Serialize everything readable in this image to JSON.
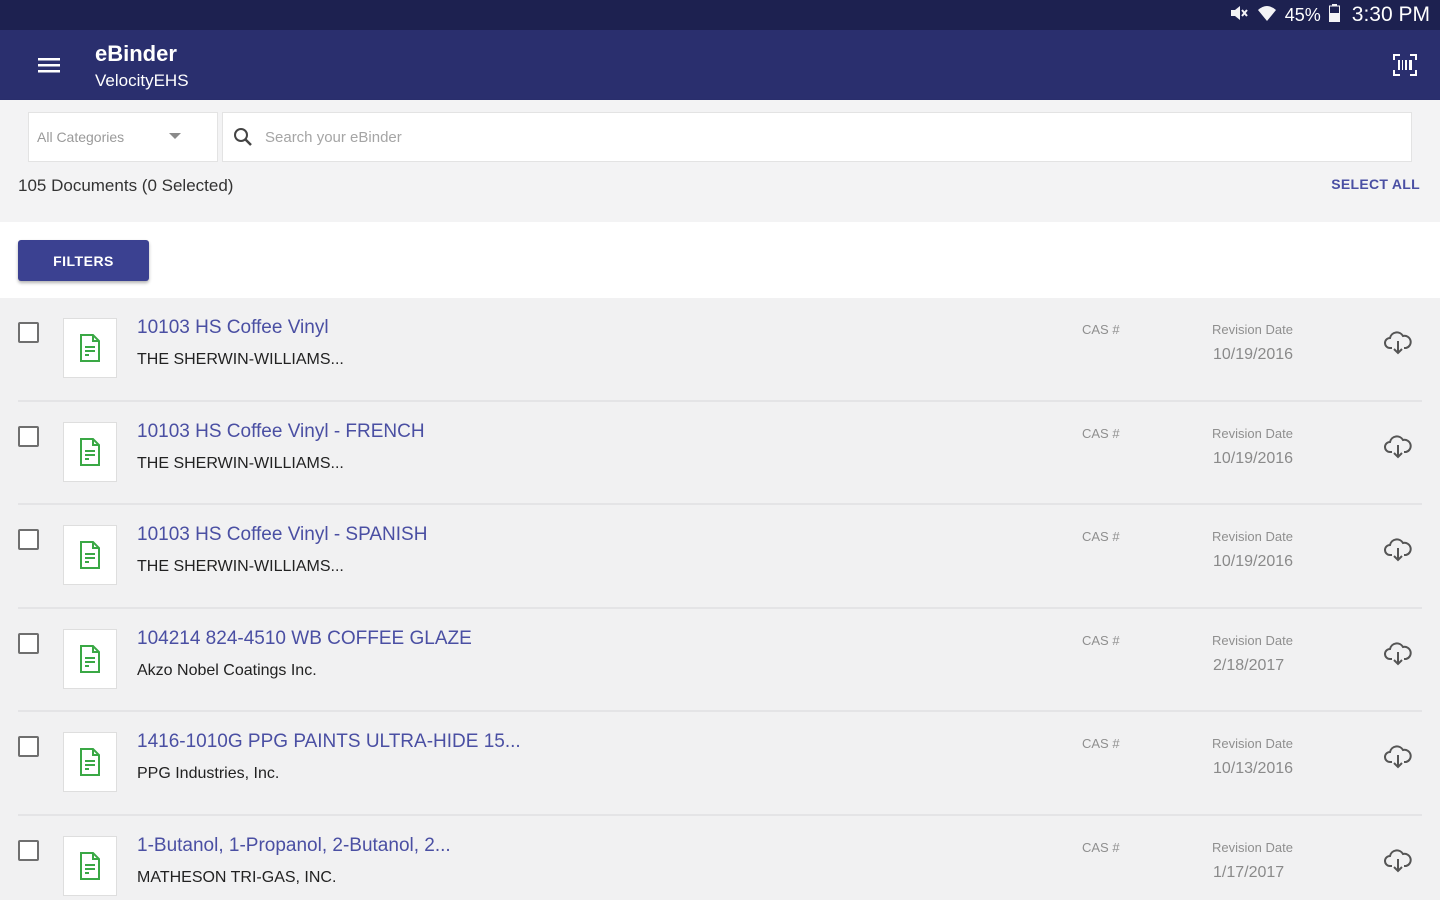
{
  "status_bar": {
    "battery": "45%",
    "time": "3:30 PM",
    "icons": [
      "mute-icon",
      "wifi-icon",
      "battery-icon"
    ]
  },
  "app_bar": {
    "title": "eBinder",
    "subtitle": "VelocityEHS",
    "background": "#2a2f6e"
  },
  "search": {
    "category": "All Categories",
    "placeholder": "Search your eBinder"
  },
  "summary": {
    "count_text": "105 Documents (0 Selected)",
    "select_all_label": "SELECT ALL"
  },
  "filters": {
    "label": "FILTERS"
  },
  "documents": [
    {
      "title": "10103 HS Coffee Vinyl",
      "manufacturer": "THE SHERWIN-WILLIAMS...",
      "cas_label": "CAS #",
      "revision_label": "Revision Date",
      "revision_date": "10/19/2016"
    },
    {
      "title": "10103 HS Coffee Vinyl - FRENCH",
      "manufacturer": "THE SHERWIN-WILLIAMS...",
      "cas_label": "CAS #",
      "revision_label": "Revision Date",
      "revision_date": "10/19/2016"
    },
    {
      "title": "10103 HS Coffee Vinyl - SPANISH",
      "manufacturer": "THE SHERWIN-WILLIAMS...",
      "cas_label": "CAS #",
      "revision_label": "Revision Date",
      "revision_date": "10/19/2016"
    },
    {
      "title": "104214 824-4510 WB COFFEE GLAZE",
      "manufacturer": "Akzo Nobel Coatings Inc.",
      "cas_label": "CAS #",
      "revision_label": "Revision Date",
      "revision_date": "2/18/2017"
    },
    {
      "title": "1416-1010G PPG PAINTS ULTRA-HIDE 15...",
      "manufacturer": "PPG Industries, Inc.",
      "cas_label": "CAS #",
      "revision_label": "Revision Date",
      "revision_date": "10/13/2016"
    },
    {
      "title": "1-Butanol, 1-Propanol, 2-Butanol, 2...",
      "manufacturer": "MATHESON TRI-GAS, INC.",
      "cas_label": "CAS #",
      "revision_label": "Revision Date",
      "revision_date": "1/17/2017"
    }
  ],
  "colors": {
    "accent": "#3b4191",
    "link": "#4a4fa3",
    "doc_icon": "#3aa845",
    "status_bar": "#1d2150"
  }
}
